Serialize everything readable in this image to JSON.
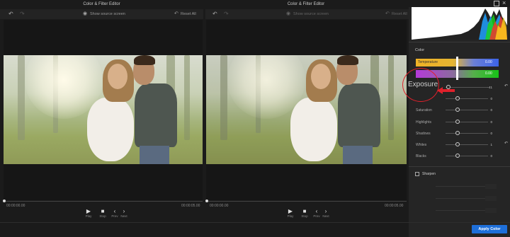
{
  "left_window": {
    "title": "Color & Filter Editor",
    "show_source": "Show source screen",
    "reset_all": "Reset All",
    "current_time": "00:00:00.00",
    "total_time": "00:00:05.00"
  },
  "right_window": {
    "title": "Color & Filter Editor",
    "show_source": "Show source screen",
    "reset_all": "Reset All",
    "current_time": "00:00:00.00",
    "total_time": "00:00:05.00"
  },
  "controls": {
    "play": "Play",
    "stop": "Stop",
    "prev": "Prev",
    "next": "Next"
  },
  "panel": {
    "color_section": "Color",
    "temperature": {
      "label": "Temperature",
      "value": "0.00"
    },
    "tint": {
      "value": "0.00"
    },
    "exposure": {
      "label": "Exposure",
      "value": "-41"
    },
    "contrast": {
      "value": "0"
    },
    "saturation": {
      "label": "Saturation",
      "value": "0"
    },
    "highlights": {
      "label": "Highlights",
      "value": "0"
    },
    "shadows": {
      "label": "Shadows",
      "value": "0"
    },
    "whites": {
      "label": "Whites",
      "value": "1"
    },
    "blacks": {
      "label": "Blacks",
      "value": "0"
    },
    "sharpen_label": "Sharpen"
  },
  "footer": {
    "apply_label": "Apply Color"
  },
  "colors": {
    "accent": "#1e6fd9",
    "annotation_red": "#e0212b",
    "background": "#1b1b1b",
    "panel": "#252525"
  },
  "icons": [
    "undo-icon",
    "redo-icon",
    "eye-icon",
    "reset-all-icon",
    "play-icon",
    "stop-icon",
    "prev-icon",
    "next-icon",
    "maximize-icon",
    "close-icon",
    "arrow-left-icon"
  ]
}
